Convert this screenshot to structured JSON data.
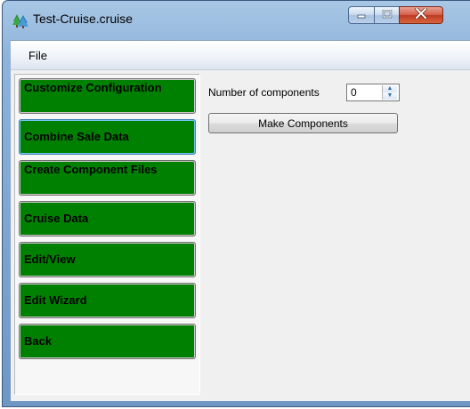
{
  "window": {
    "title": "Test-Cruise.cruise",
    "icon": "app-tree-icon",
    "controls": {
      "minimize_icon": "minimize-icon",
      "maximize_icon": "maximize-icon",
      "close_icon": "close-icon"
    }
  },
  "menu": {
    "items": [
      {
        "label": "File"
      }
    ]
  },
  "sidebar": {
    "items": [
      {
        "label": "Customize Configuration"
      },
      {
        "label": "Combine Sale Data",
        "focused": true
      },
      {
        "label": "Create Component Files"
      },
      {
        "label": "Cruise Data"
      },
      {
        "label": "Edit/View"
      },
      {
        "label": "Edit Wizard"
      },
      {
        "label": "Back"
      }
    ],
    "button_color": "#008000",
    "focus_color": "#74c6ee"
  },
  "main": {
    "components_label": "Number of components",
    "components_value": "0",
    "make_button_label": "Make Components"
  },
  "colors": {
    "client_background": "#f0f0f0",
    "title_gradient_top": "#a8c7e6",
    "close_button": "#c03a22"
  }
}
